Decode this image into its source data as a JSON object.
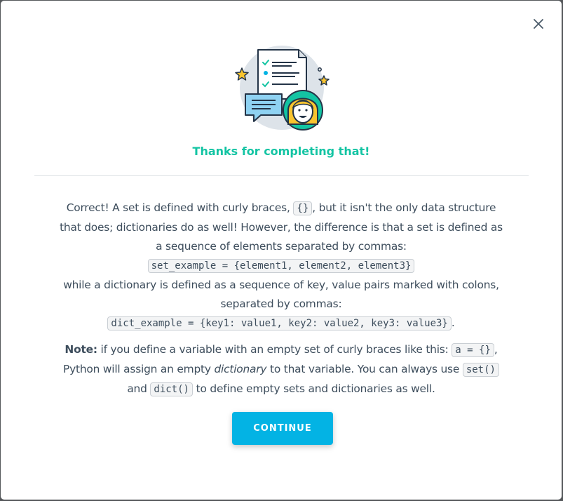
{
  "modal": {
    "headline": "Thanks for completing that!",
    "paragraph1": {
      "t1": "Correct! A set is defined with curly braces, ",
      "code1": "{}",
      "t2": ", but it isn't the only data structure that does; dictionaries do as well! However, the difference is that a set is defined as a sequence of elements separated by commas:",
      "code2": "set_example = {element1, element2, element3}",
      "t3": "while a dictionary is defined as a sequence of key, value pairs marked with colons, separated by commas:",
      "code3": "dict_example = {key1: value1, key2: value2, key3: value3}",
      "t4": "."
    },
    "paragraph2": {
      "label": "Note:",
      "t1": " if you define a variable with an empty set of curly braces like this: ",
      "code1": "a = {}",
      "t2": ", Python will assign an empty ",
      "em": "dictionary",
      "t3": " to that variable. You can always use ",
      "code2": "set()",
      "t4": " and ",
      "code3": "dict()",
      "t5": " to define empty sets and dictionaries as well."
    },
    "continue_label": "CONTINUE",
    "icons": {
      "close": "close-icon",
      "illustration": "success-illustration"
    },
    "colors": {
      "accent": "#13c4a3",
      "button": "#03b3e4",
      "text": "#3d4d5c"
    }
  }
}
